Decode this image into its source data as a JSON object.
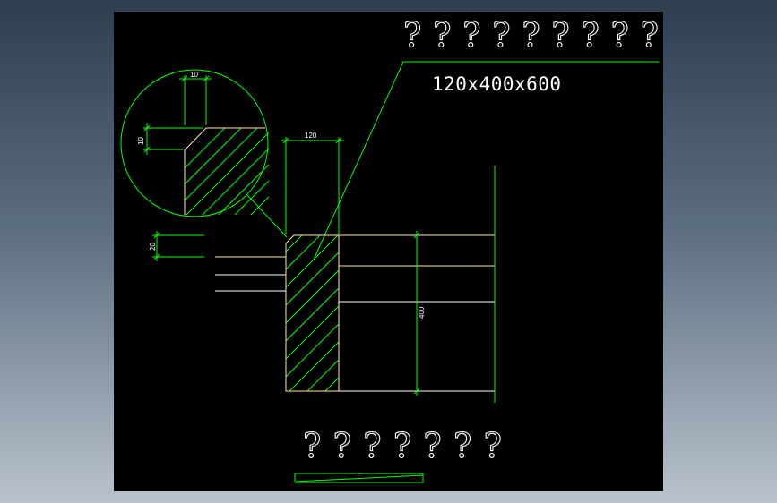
{
  "drawing": {
    "colors": {
      "background": "#000000",
      "dimension_lines": "#00ff00",
      "outline": "#ffe3a8",
      "text": "#ffffff"
    },
    "title_top": "?????????",
    "title_bottom": "???????",
    "spec_label": "120x400x600",
    "dimensions": {
      "width_top": "120",
      "height_right": "400",
      "side_offset": "20",
      "detail_horizontal": "10",
      "detail_vertical": "10"
    }
  }
}
